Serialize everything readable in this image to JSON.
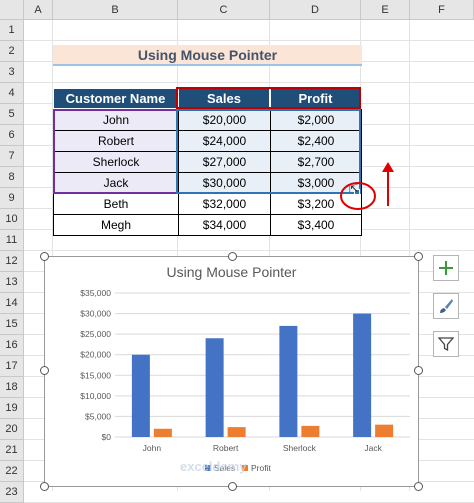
{
  "columns": [
    "A",
    "B",
    "C",
    "D",
    "E",
    "F"
  ],
  "rows": [
    "1",
    "2",
    "3",
    "4",
    "5",
    "6",
    "7",
    "8",
    "9",
    "10",
    "11",
    "12",
    "13",
    "14",
    "15",
    "16",
    "17",
    "18",
    "19",
    "20",
    "21",
    "22",
    "23"
  ],
  "title": "Using Mouse Pointer",
  "table": {
    "headers": [
      "Customer Name",
      "Sales",
      "Profit"
    ],
    "rows": [
      [
        "John",
        "$20,000",
        "$2,000"
      ],
      [
        "Robert",
        "$24,000",
        "$2,400"
      ],
      [
        "Sherlock",
        "$27,000",
        "$2,700"
      ],
      [
        "Jack",
        "$30,000",
        "$3,000"
      ],
      [
        "Beth",
        "$32,000",
        "$3,200"
      ],
      [
        "Megh",
        "$34,000",
        "$3,400"
      ]
    ]
  },
  "colors": {
    "header_fill": "#1f4e79",
    "title_fill": "#fbe5d6",
    "sales_bar": "#4472c4",
    "profit_bar": "#ed7d31",
    "annotation": "#e00000"
  },
  "side_buttons": [
    "plus-icon",
    "brush-icon",
    "filter-icon"
  ],
  "watermark": "exceldemy",
  "chart_data": {
    "type": "bar",
    "title": "Using Mouse Pointer",
    "categories": [
      "John",
      "Robert",
      "Sherlock",
      "Jack"
    ],
    "series": [
      {
        "name": "Sales",
        "values": [
          20000,
          24000,
          27000,
          30000
        ]
      },
      {
        "name": "Profit",
        "values": [
          2000,
          2400,
          2700,
          3000
        ]
      }
    ],
    "yticks": [
      "$0",
      "$5,000",
      "$10,000",
      "$15,000",
      "$20,000",
      "$25,000",
      "$30,000",
      "$35,000"
    ],
    "ylim": [
      0,
      35000
    ],
    "legend": "bottom",
    "grid": true
  }
}
